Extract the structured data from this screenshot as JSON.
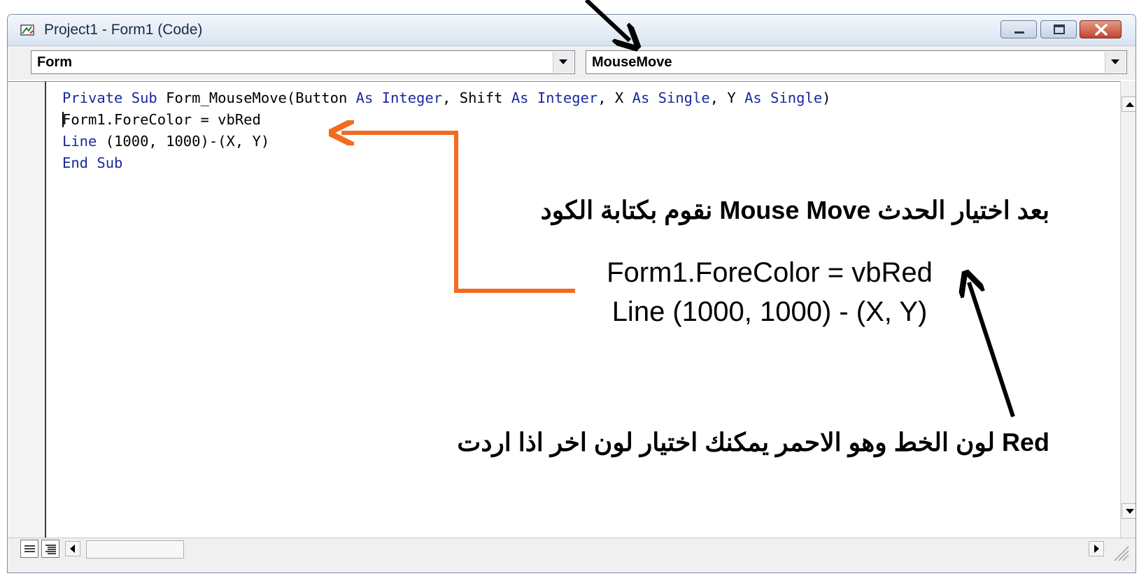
{
  "window": {
    "title": "Project1 - Form1 (Code)",
    "minimize_icon": "minimize-icon",
    "maximize_icon": "restore-icon",
    "close_icon": "close-icon"
  },
  "object_combo": {
    "value": "Form"
  },
  "procedure_combo": {
    "value": "MouseMove"
  },
  "code_lines": [
    {
      "parts": [
        "Private Sub ",
        "Form_MouseMove(Button ",
        "As Integer",
        ", Shift ",
        "As Integer",
        ", X ",
        "As Single",
        ", Y ",
        "As Single",
        ")"
      ]
    },
    {
      "text": "Form1.ForeColor = vbRed"
    },
    {
      "kw": "Line",
      "rest": " (1000, 1000)-(X, Y)"
    },
    {
      "text": "End Sub"
    }
  ],
  "annotations": {
    "arabic_line_1": "بعد اختيار الحدث Mouse Move نقوم بكتابة الكود",
    "code_line_1": "Form1.ForeColor = vbRed",
    "code_line_2": "Line (1000, 1000) - (X, Y)",
    "arabic_line_2": "Red لون الخط وهو الاحمر يمكنك اختيار لون اخر اذا اردت"
  },
  "colors": {
    "keyword": "#1a2a9c",
    "orange_arrow": "#f26b1f",
    "black_arrow": "#000000"
  }
}
